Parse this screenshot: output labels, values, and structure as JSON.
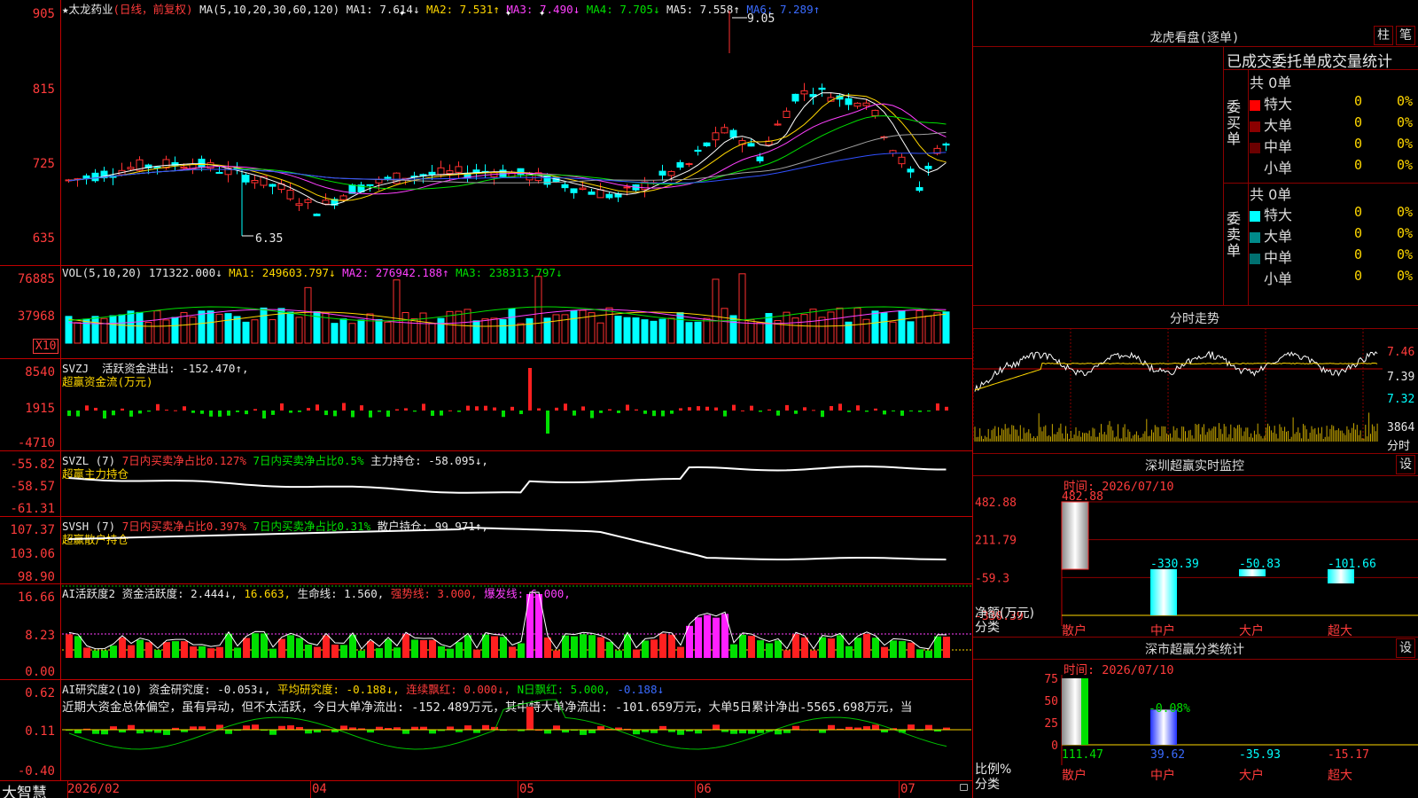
{
  "kline": {
    "stock_title": "★太龙药业",
    "period": "(日线，前复权)",
    "ma_label": "MA(5,10,20,30,60,120)",
    "ma1": "MA1: 7.614↓",
    "ma2": "MA2: 7.531↑",
    "ma3": "MA3: 7.490↓",
    "ma4": "MA4: 7.705↓",
    "ma5": "MA5: 7.558↑",
    "ma6": "MA6: 7.289↑",
    "high_marker": "9.05",
    "low_marker": "6.35",
    "y_ticks": [
      "905",
      "815",
      "725",
      "635"
    ]
  },
  "vol": {
    "title": "VOL(5,10,20)",
    "value": "171322.000↓",
    "ma1": "MA1: 249603.797↓",
    "ma2": "MA2: 276942.188↑",
    "ma3": "MA3: 238313.797↓",
    "y_ticks": [
      "76885",
      "37968"
    ],
    "unit": "X10"
  },
  "svzj": {
    "title": "SVZJ",
    "line1": "活跃资金进出: -152.470↑,",
    "line2": "超赢资金流(万元)",
    "y_ticks": [
      "8540",
      "1915",
      "-4710"
    ]
  },
  "svzl": {
    "title": "SVZL (7)",
    "t1": "7日内买卖净占比0.127%",
    "t2": "7日内买卖净占比0.5%",
    "t3": "主力持仓: -58.095↓,",
    "line2": "超赢主力持仓",
    "y_ticks": [
      "-55.82",
      "-58.57",
      "-61.31"
    ]
  },
  "svsh": {
    "title": "SVSH (7)",
    "t1": "7日内买卖净占比0.397%",
    "t2": "7日内买卖净占比0.31%",
    "t3": "散户持仓: 99.971↑,",
    "line2": "超赢散户持仓",
    "y_ticks": [
      "107.37",
      "103.06",
      "98.90"
    ]
  },
  "ai_active": {
    "title": "AI活跃度2 资金活跃度: 2.444↓,",
    "v2": "16.663,",
    "v3": "生命线: 1.560,",
    "v4": "强势线: 3.000,",
    "v5": "爆发线: 6.000,",
    "y_ticks": [
      "16.66",
      "8.23",
      "0.00"
    ]
  },
  "ai_research": {
    "title": "AI研究度2(10) 资金研究度: -0.053↓,",
    "v2": "平均研究度: -0.188↓,",
    "v3": "连续飘红: 0.000↓,",
    "v4": "N日飘红: 5.000,",
    "v5": "-0.188↓",
    "comment": "近期大资金总体偏空，虽有异动，但不太活跃，今日大单净流出: -152.489万元，其中特大单净流出: -101.659万元，大单5日累计净出-5565.698万元，当",
    "y_ticks": [
      "0.62",
      "0.11",
      "-0.40"
    ]
  },
  "bottom_axis": {
    "logo": "大智慧",
    "dates": [
      "2026/02",
      "04",
      "05",
      "06",
      "07"
    ]
  },
  "longhu": {
    "title": "龙虎看盘(逐单)",
    "btn1": "柱",
    "btn2": "笔",
    "tabs": "已成交委托单成交量统计",
    "buy_label": "委买单",
    "sell_label": "委卖单",
    "buy_total": "共 0单",
    "sell_total": "共 0单",
    "rows": [
      "特大",
      "大单",
      "中单",
      "小单"
    ],
    "zero": "0",
    "pct": "0%",
    "buy_colors": [
      "#ff0000",
      "#8b0000",
      "#6b0000",
      "#000000"
    ],
    "sell_colors": [
      "#00ffff",
      "#008b8b",
      "#007070",
      "#000000"
    ]
  },
  "fenshi": {
    "title": "分时走势",
    "y_ticks": [
      "7.46",
      "7.39",
      "7.32"
    ],
    "vol_tick": "3864",
    "unit": "分时"
  },
  "sz_monitor": {
    "title": "深圳超赢实时监控",
    "btn": "设",
    "time": "时间: 2026/07/10",
    "y_ticks": [
      "482.88",
      "211.79",
      "-59.3",
      "-330.39"
    ],
    "net_label": "净额(万元)",
    "cat_label": "分类",
    "categories": [
      "散户",
      "中户",
      "大户",
      "超大"
    ],
    "values": [
      482.88,
      -330.39,
      -50.83,
      -101.66
    ],
    "value_labels": [
      "482.88",
      "-330.39",
      "-50.83",
      "-101.66"
    ]
  },
  "sz_class": {
    "title": "深市超赢分类统计",
    "btn": "设",
    "time": "时间: 2026/07/10",
    "y_ticks": [
      "75",
      "50",
      "25",
      "0"
    ],
    "ratio_label": "比例%",
    "cat_label": "分类",
    "categories": [
      "散户",
      "中户",
      "大户",
      "超大"
    ],
    "top_label": "-0.08%",
    "values": [
      111.47,
      39.62,
      -35.93,
      -15.17
    ],
    "value_labels": [
      "111.47",
      "39.62",
      "-35.93",
      "-15.17"
    ]
  }
}
